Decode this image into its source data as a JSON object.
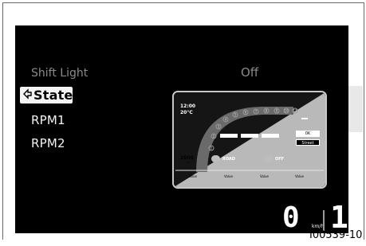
{
  "menu": {
    "title": "Shift Light",
    "current_value": "Off",
    "items": [
      {
        "label": "State",
        "selected": true
      },
      {
        "label": "RPM1",
        "selected": false
      },
      {
        "label": "RPM2",
        "selected": false
      }
    ]
  },
  "preview": {
    "time": "12:00",
    "temperature": "20°C",
    "odometer": "2000",
    "odometer_unit": "km",
    "trip": "0K",
    "riding_mode": "Street",
    "traction_label": "ROAD",
    "abs_label": "OFF",
    "bottom_labels": [
      "Value",
      "Value",
      "Value",
      "Value"
    ],
    "rpm_scale": [
      "1",
      "2",
      "3",
      "4",
      "5",
      "6",
      "7",
      "8",
      "9",
      "10",
      "11"
    ]
  },
  "status": {
    "speed": "0",
    "speed_unit": "km/h",
    "gear": "1"
  },
  "figure_id": "I00539-10",
  "colors": {
    "screen_background": "#000000",
    "selected_background": "#f4f4f4",
    "dim_text": "#8a8a8a",
    "bright_text": "#f2f2f2"
  }
}
